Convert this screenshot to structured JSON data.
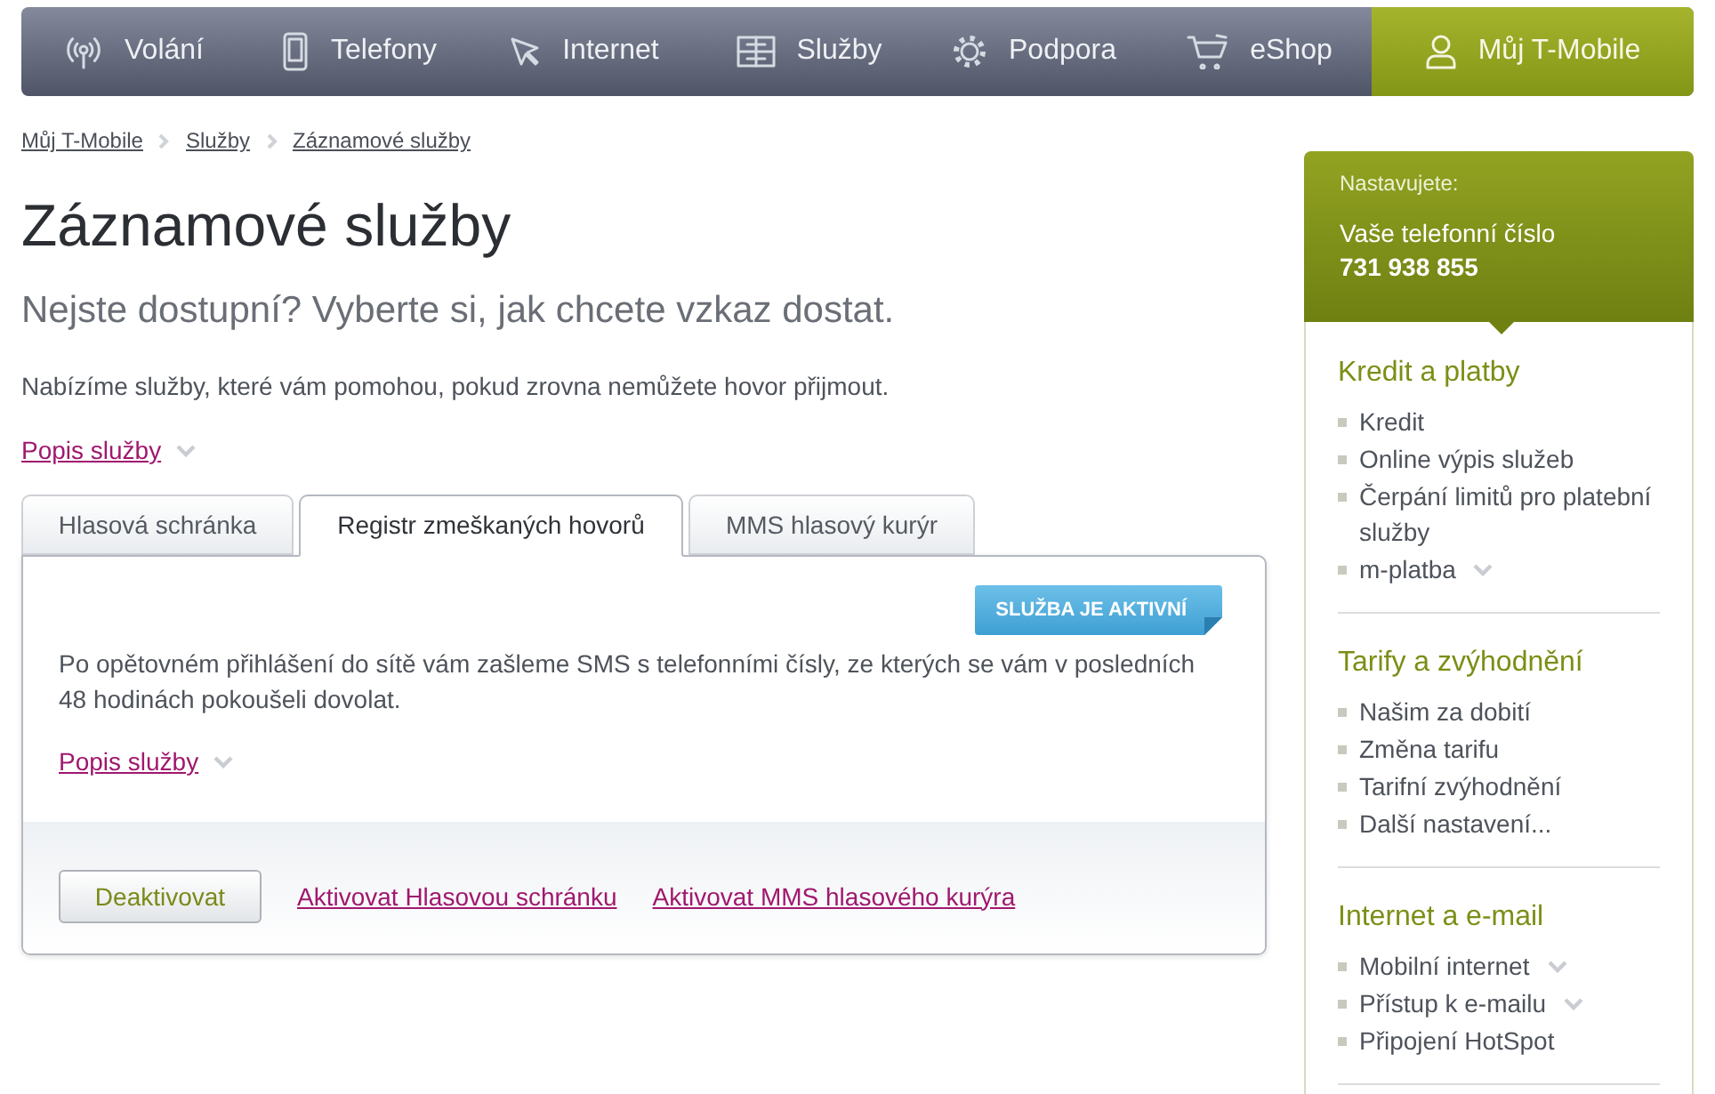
{
  "nav": [
    {
      "label": "Volání",
      "selected": false
    },
    {
      "label": "Telefony",
      "selected": false
    },
    {
      "label": "Internet",
      "selected": false
    },
    {
      "label": "Služby",
      "selected": false
    },
    {
      "label": "Podpora",
      "selected": false
    },
    {
      "label": "eShop",
      "selected": false
    },
    {
      "label": "Můj T-Mobile",
      "selected": true
    }
  ],
  "breadcrumb": [
    "Můj T-Mobile",
    "Služby",
    "Záznamové služby"
  ],
  "page": {
    "title": "Záznamové služby",
    "subtitle": "Nejste dostupní? Vyberte si, jak chcete vzkaz dostat.",
    "intro": "Nabízíme služby, které vám pomohou, pokud zrovna nemůžete hovor přijmout.",
    "more_link": "Popis služby"
  },
  "tabs": [
    {
      "label": "Hlasová schránka",
      "selected": false
    },
    {
      "label": "Registr zmeškaných hovorů",
      "selected": true
    },
    {
      "label": "MMS hlasový kurýr",
      "selected": false
    }
  ],
  "panel": {
    "status_badge": "SLUŽBA JE AKTIVNÍ",
    "description": "Po opětovném přihlášení do sítě vám zašleme SMS s telefonními čísly, ze kterých se vám v posledních 48 hodinách pokoušeli dovolat.",
    "more_link": "Popis služby",
    "button": "Deaktivovat",
    "links": [
      "Aktivovat Hlasovou schránku",
      "Aktivovat MMS hlasového kurýra"
    ]
  },
  "sidebar": {
    "header": {
      "caption": "Nastavujete:",
      "label": "Vaše telefonní číslo",
      "number": "731 938 855"
    },
    "sections": [
      {
        "title": "Kredit a platby",
        "items": [
          {
            "label": "Kredit",
            "expandable": false
          },
          {
            "label": "Online výpis služeb",
            "expandable": false
          },
          {
            "label": "Čerpání limitů pro platební služby",
            "expandable": false
          },
          {
            "label": "m-platba",
            "expandable": true
          }
        ]
      },
      {
        "title": "Tarify a zvýhodnění",
        "items": [
          {
            "label": "Našim za dobití",
            "expandable": false
          },
          {
            "label": "Změna tarifu",
            "expandable": false
          },
          {
            "label": "Tarifní zvýhodnění",
            "expandable": false
          },
          {
            "label": "Další nastavení...",
            "expandable": false
          }
        ]
      },
      {
        "title": "Internet a e-mail",
        "items": [
          {
            "label": "Mobilní internet",
            "expandable": true
          },
          {
            "label": "Přístup k e-mailu",
            "expandable": true
          },
          {
            "label": "Připojení HotSpot",
            "expandable": false
          }
        ]
      }
    ]
  }
}
